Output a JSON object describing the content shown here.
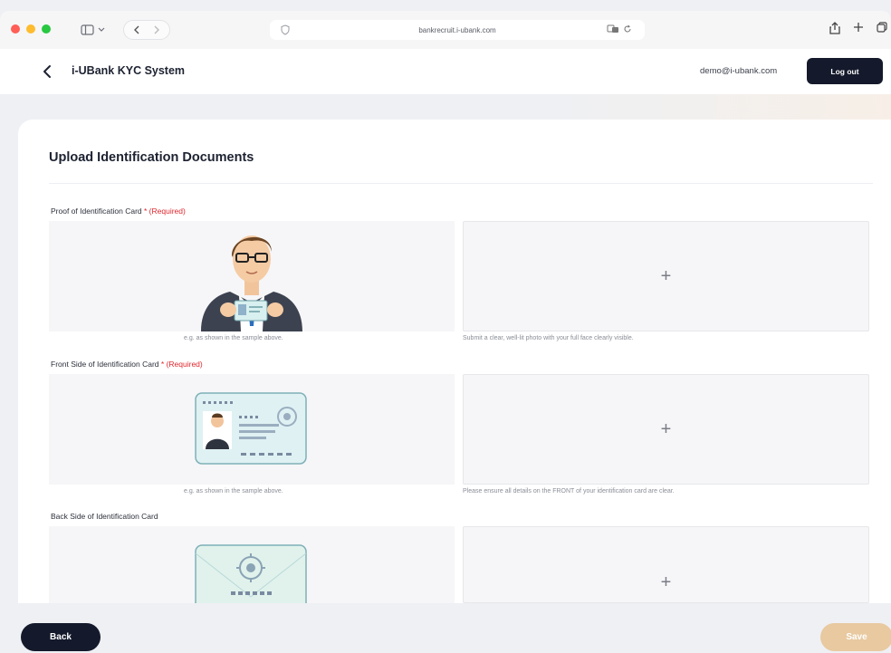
{
  "browser": {
    "url": "bankrecruit.i-ubank.com"
  },
  "header": {
    "title": "i-UBank KYC System",
    "user_email": "demo@i-ubank.com",
    "logout_label": "Log out"
  },
  "main": {
    "section_title": "Upload Identification Documents",
    "fields": [
      {
        "label": "Proof of Identification Card",
        "required_mark": " * ",
        "required_text": "(Required)",
        "sample_caption": "e.g. as shown in the sample above.",
        "upload_hint": "Submit a clear, well-lit photo with your full face clearly visible.",
        "upload_symbol": "+"
      },
      {
        "label": "Front Side of Identification Card",
        "required_mark": " * ",
        "required_text": "(Required)",
        "sample_caption": "e.g. as shown in the sample above.",
        "upload_hint": "Please ensure all details on the FRONT of your identification card are clear.",
        "upload_symbol": "+"
      },
      {
        "label": "Back Side of Identification Card",
        "upload_symbol": "+"
      }
    ]
  },
  "footer": {
    "back_label": "Back",
    "save_label": "Save"
  },
  "colors": {
    "primary": "#141a2b",
    "required": "#e0262d",
    "save_disabled": "#e8c9a0"
  }
}
